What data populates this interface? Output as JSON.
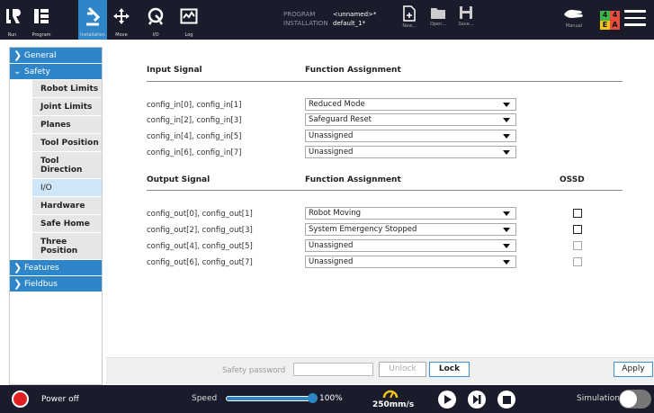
{
  "header": {
    "nav": [
      {
        "label": "Run",
        "icon": "ur-logo-icon"
      },
      {
        "label": "Program",
        "icon": "program-icon"
      },
      {
        "label": "Installation",
        "icon": "installation-icon"
      },
      {
        "label": "Move",
        "icon": "move-icon"
      },
      {
        "label": "I/O",
        "icon": "io-icon"
      },
      {
        "label": "Log",
        "icon": "log-icon"
      }
    ],
    "program_key": "PROGRAM",
    "program_value": "<unnamed>*",
    "installation_key": "INSTALLATION",
    "installation_value": "default_1*",
    "file_buttons": [
      {
        "label": "New...",
        "icon": "new-file-icon"
      },
      {
        "label": "Open...",
        "icon": "open-folder-icon"
      },
      {
        "label": "Save...",
        "icon": "save-icon"
      }
    ],
    "mode_label": "Manual",
    "status_grid": [
      "4",
      "4",
      "E",
      "A"
    ],
    "status_colors": [
      "#3bb54a",
      "#e84c3d",
      "#f2c318",
      "#e84c3d"
    ]
  },
  "sidebar": {
    "general": "General",
    "safety": "Safety",
    "safety_items": [
      "Robot Limits",
      "Joint Limits",
      "Planes",
      "Tool Position",
      "Tool Direction",
      "I/O",
      "Hardware",
      "Safe Home",
      "Three Position"
    ],
    "selected": "I/O",
    "features": "Features",
    "fieldbus": "Fieldbus"
  },
  "io": {
    "input_header": "Input Signal",
    "function_header": "Function Assignment",
    "inputs": [
      {
        "signal": "config_in[0], config_in[1]",
        "function": "Reduced Mode"
      },
      {
        "signal": "config_in[2], config_in[3]",
        "function": "Safeguard Reset"
      },
      {
        "signal": "config_in[4], config_in[5]",
        "function": "Unassigned"
      },
      {
        "signal": "config_in[6], config_in[7]",
        "function": "Unassigned"
      }
    ],
    "output_header": "Output Signal",
    "output_function_header": "Function Assignment",
    "ossd_header": "OSSD",
    "outputs": [
      {
        "signal": "config_out[0], config_out[1]",
        "function": "Robot Moving",
        "ossd_enabled": true
      },
      {
        "signal": "config_out[2], config_out[3]",
        "function": "System Emergency Stopped",
        "ossd_enabled": true
      },
      {
        "signal": "config_out[4], config_out[5]",
        "function": "Unassigned",
        "ossd_enabled": false
      },
      {
        "signal": "config_out[6], config_out[7]",
        "function": "Unassigned",
        "ossd_enabled": false
      }
    ]
  },
  "password_bar": {
    "label": "Safety password",
    "value": "",
    "unlock": "Unlock",
    "lock": "Lock",
    "apply": "Apply"
  },
  "footer": {
    "power": "Power off",
    "speed_label": "Speed",
    "speed_percent": "100%",
    "speed_fraction": 1.0,
    "tcp_speed": "250mm/s",
    "simulation_label": "Simulation",
    "simulation_on": false,
    "accent": "#2e86c8"
  }
}
